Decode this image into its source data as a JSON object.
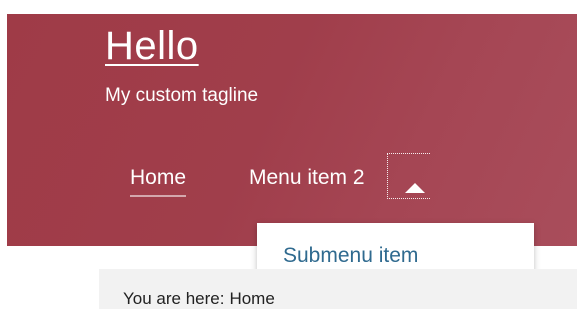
{
  "site": {
    "title": "Hello",
    "tagline": "My custom tagline"
  },
  "nav": {
    "items": [
      {
        "label": "Home"
      },
      {
        "label": "Menu item 2"
      }
    ],
    "toggle_icon": "caret-up-icon"
  },
  "submenu": {
    "items": [
      {
        "label": "Submenu item"
      }
    ]
  },
  "breadcrumb": {
    "prefix": "You are here:",
    "current": "Home"
  },
  "colors": {
    "header_bg": "#a03e4b",
    "link": "#2f6a8f",
    "breadcrumb_bg": "#f2f2f2"
  }
}
